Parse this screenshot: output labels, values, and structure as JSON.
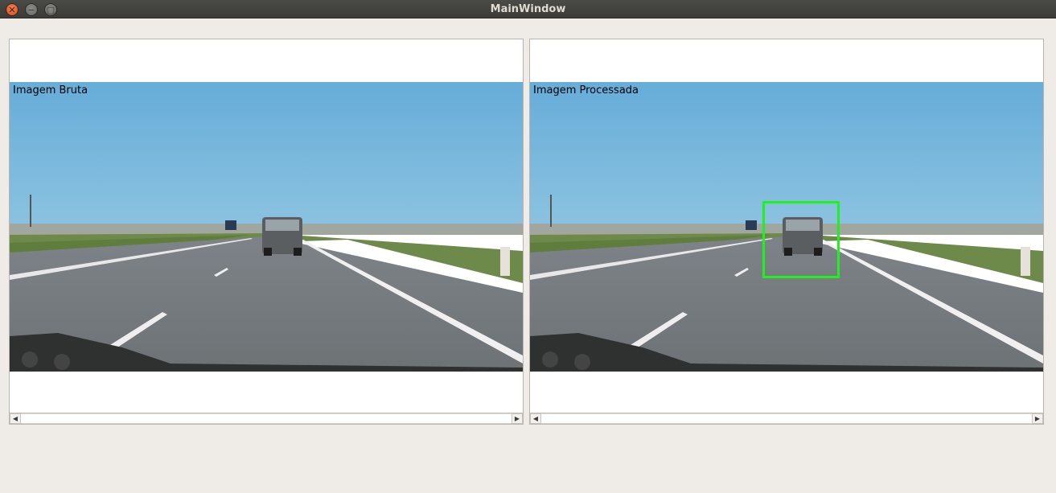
{
  "window": {
    "title": "MainWindow"
  },
  "panels": {
    "raw": {
      "caption": "Imagem Bruta"
    },
    "processed": {
      "caption": "Imagem Processada"
    }
  },
  "colors": {
    "detection_box": "#1ef11e",
    "sky": "#5ea9d8",
    "road": "#8a8c8d"
  },
  "icons": {
    "close": "close-icon",
    "minimize": "minimize-icon",
    "maximize": "maximize-icon",
    "scroll_left": "arrow-left-icon",
    "scroll_right": "arrow-right-icon"
  }
}
